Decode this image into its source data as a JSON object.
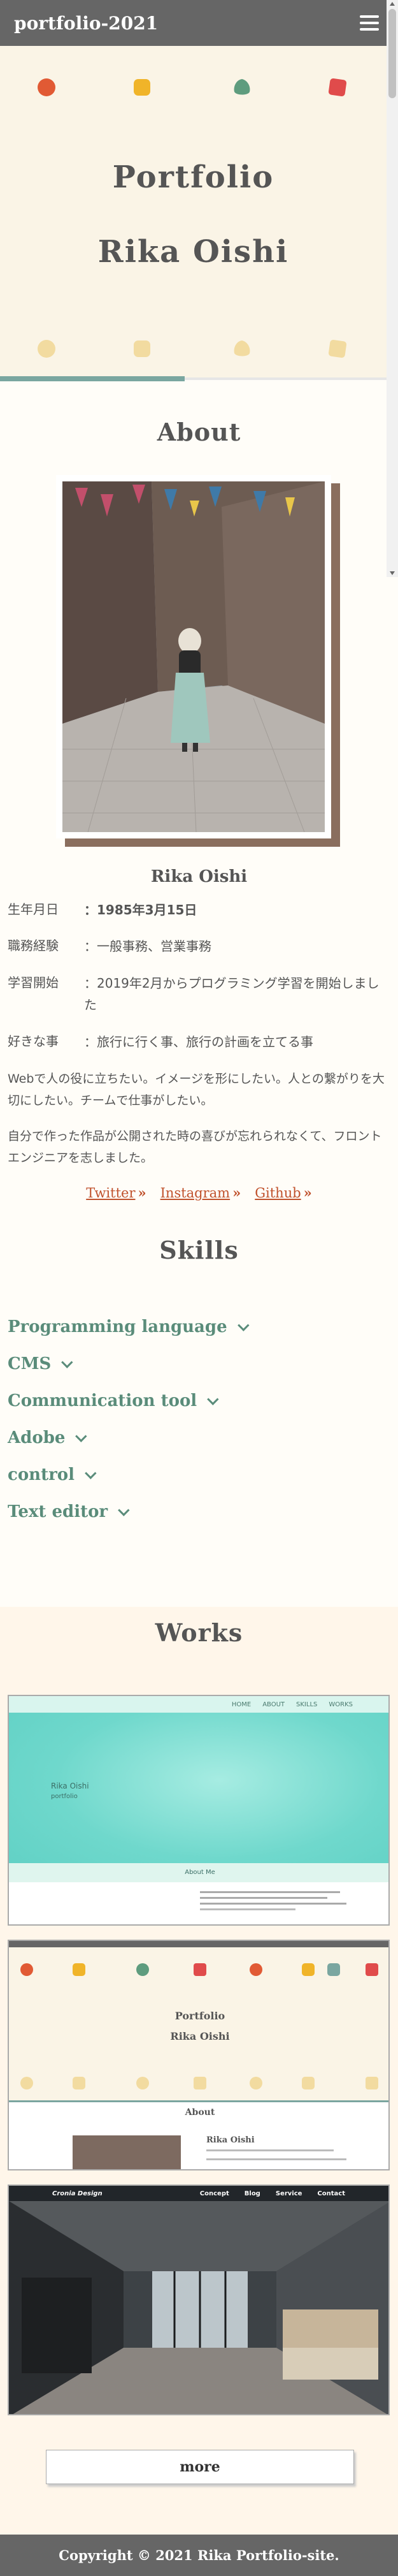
{
  "header": {
    "logo": "portfolio-2021",
    "menu_icon": "hamburger-icon"
  },
  "hero": {
    "title_line1": "Portfolio",
    "title_line2": "Rika Oishi",
    "top_dots": [
      "#e15a34",
      "#f0b429",
      "#5e9c7e",
      "#e04b4b"
    ],
    "bottom_dots": [
      "#f2dba0",
      "#f2dba0",
      "#f2dba0",
      "#f2dba0"
    ],
    "progress": 0.48
  },
  "about": {
    "title": "About",
    "name": "Rika Oishi",
    "profile": [
      {
        "label": "生年月日",
        "value": "：1985年3月15日"
      },
      {
        "label": "職務経験",
        "value": "：一般事務、営業事務"
      },
      {
        "label": "学習開始",
        "value": "：2019年2月からプログラミング学習を開始しました"
      },
      {
        "label": "好きな事",
        "value": "：旅行に行く事、旅行の計画を立てる事"
      }
    ],
    "para1": "Webで人の役に立ちたい。イメージを形にしたい。人との繋がりを大切にしたい。チームで仕事がしたい。",
    "para2": "自分で作った作品が公開された時の喜びが忘れられなくて、フロントエンジニアを志しました。",
    "links": [
      "Twitter",
      "Instagram",
      "Github"
    ]
  },
  "skills": {
    "title": "Skills",
    "items": [
      "Programming language",
      "CMS",
      "Communication tool",
      "Adobe",
      "control",
      "Text editor"
    ]
  },
  "works": {
    "title": "Works",
    "card1": {
      "nav": [
        "HOME",
        "ABOUT",
        "SKILLS",
        "WORKS"
      ],
      "name": "Rika Oishi",
      "sub": "portfolio",
      "section": "About Me"
    },
    "card2": {
      "title1": "Portfolio",
      "title2": "Rika Oishi",
      "section": "About",
      "name": "Rika Oishi"
    },
    "card3": {
      "brand": "Cronia Design",
      "nav": [
        "Concept",
        "Blog",
        "Service",
        "Contact"
      ]
    },
    "more": "more"
  },
  "footer": {
    "copyright": "Copyright © 2021 Rika Portfolio-site."
  }
}
